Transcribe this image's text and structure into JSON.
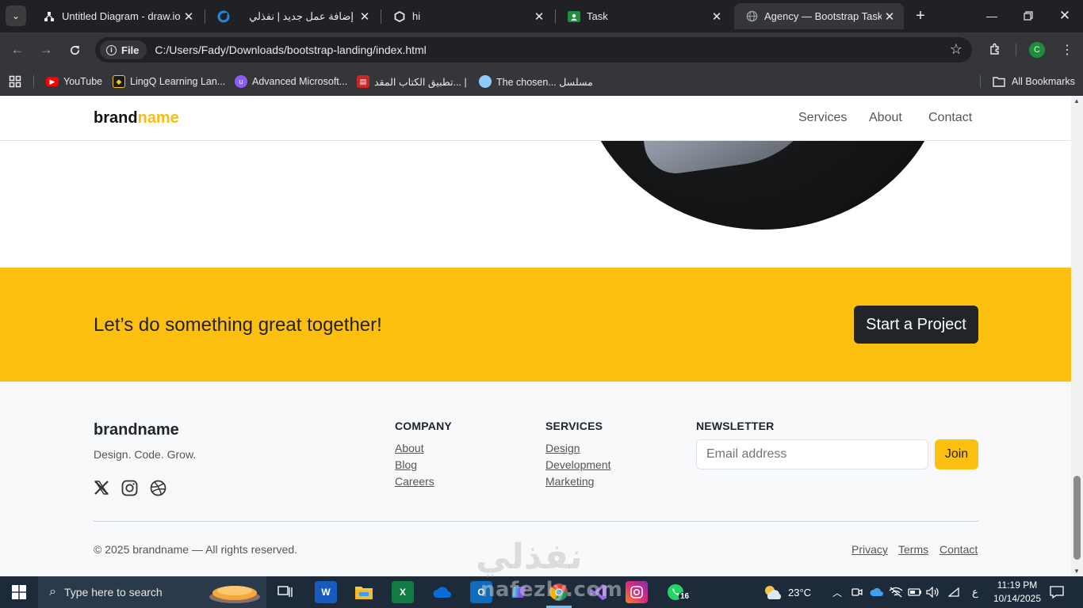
{
  "browser": {
    "tabs": [
      {
        "title": "Untitled Diagram - draw.io",
        "icon": "drawio-icon"
      },
      {
        "title": "إضافة عمل جديد | نفذلي",
        "icon": "nafezly-icon"
      },
      {
        "title": "hi",
        "icon": "hex-icon"
      },
      {
        "title": "Task",
        "icon": "classroom-icon"
      },
      {
        "title": "Agency — Bootstrap Task",
        "icon": "globe-icon",
        "active": true
      }
    ],
    "address": {
      "scheme_chip": "File",
      "url": "C:/Users/Fady/Downloads/bootstrap-landing/index.html"
    },
    "profile_initial": "C",
    "bookmarks": [
      {
        "label": "YouTube",
        "color": "#ff0000"
      },
      {
        "label": "LingQ Learning Lan...",
        "color": "#f5c518"
      },
      {
        "label": "Advanced Microsoft...",
        "color": "#8b5cf6"
      },
      {
        "label": "تطبيق الكتاب المقد... |",
        "color": "#c62828"
      },
      {
        "label": "The chosen... مسلسل",
        "color": "#90caf9"
      }
    ],
    "all_bookmarks": "All Bookmarks"
  },
  "page": {
    "brand": {
      "part1": "brand",
      "part2": "name"
    },
    "nav": [
      "Services",
      "About",
      "Contact"
    ],
    "cta": {
      "title": "Let’s do something great together!",
      "button": "Start a Project"
    },
    "footer": {
      "brand": "brandname",
      "tagline": "Design. Code. Grow.",
      "company": {
        "heading": "COMPANY",
        "links": [
          "About",
          "Blog",
          "Careers"
        ]
      },
      "services": {
        "heading": "SERVICES",
        "links": [
          "Design",
          "Development",
          "Marketing"
        ]
      },
      "newsletter": {
        "heading": "NEWSLETTER",
        "placeholder": "Email address",
        "button": "Join"
      },
      "copyright": "© 2025 brandname — All rights reserved.",
      "legal": [
        "Privacy",
        "Terms",
        "Contact"
      ]
    },
    "accent_color": "#fdc011"
  },
  "watermark": {
    "arabic": "نفذلي",
    "latin": "nafezly.com"
  },
  "taskbar": {
    "search_placeholder": "Type here to search",
    "weather": "23°C",
    "lang": "ع",
    "time": "11:19 PM",
    "date": "10/14/2025",
    "whatsapp_badge": "16"
  }
}
